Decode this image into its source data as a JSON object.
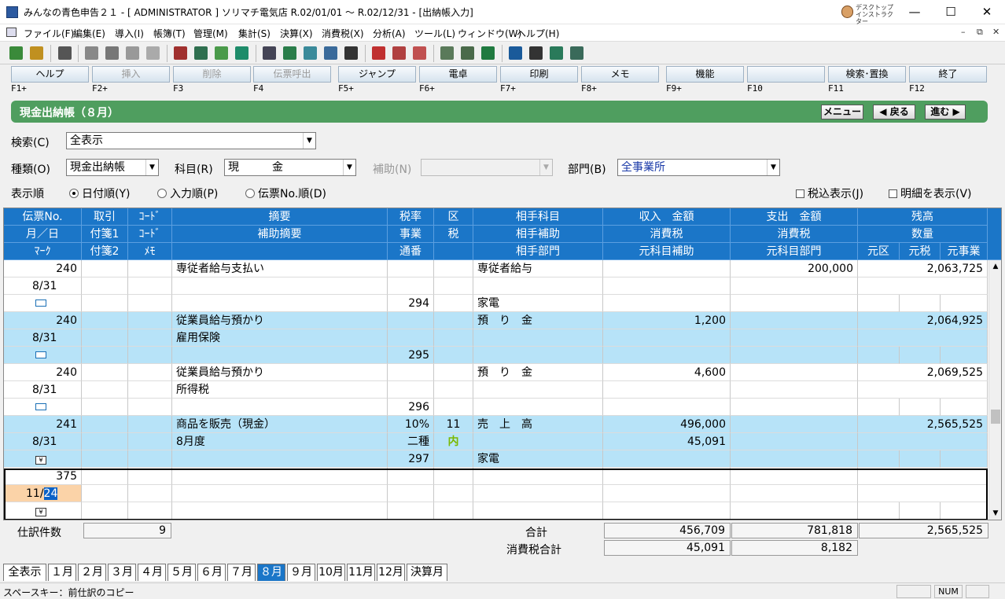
{
  "title": "みんなの青色申告２１ - [ ADMINISTRATOR ] ソリマチ電気店 R.02/01/01 ～ R.02/12/31 - [出納帳入力]",
  "desktop_instructor": [
    "デスクトップ",
    "インストラクター"
  ],
  "window_controls": {
    "min": "—",
    "max": "☐",
    "close": "✕"
  },
  "mdi_controls": {
    "min": "–",
    "restore": "⧉",
    "close": "✕"
  },
  "menu": [
    "ファイル(F)",
    "編集(E)",
    "導入(I)",
    "帳簿(T)",
    "管理(M)",
    "集計(S)",
    "決算(X)",
    "消費税(X)",
    "分析(A)",
    "ツール(L)",
    "ウィンドウ(W)",
    "ヘルプ(H)"
  ],
  "fkeys": [
    {
      "label": "ヘルプ",
      "key": "F1+",
      "disabled": false
    },
    {
      "label": "挿入",
      "key": "F2+",
      "disabled": true
    },
    {
      "label": "削除",
      "key": "F3",
      "disabled": true
    },
    {
      "label": "伝票呼出",
      "key": "F4",
      "disabled": true
    },
    {
      "label": "ジャンプ",
      "key": "F5+",
      "disabled": false
    },
    {
      "label": "電卓",
      "key": "F6+",
      "disabled": false
    },
    {
      "label": "印刷",
      "key": "F7+",
      "disabled": false
    },
    {
      "label": "メモ",
      "key": "F8+",
      "disabled": false
    },
    {
      "label": "機能",
      "key": "F9+",
      "disabled": false
    },
    {
      "label": "",
      "key": "F10",
      "disabled": false
    },
    {
      "label": "検索･置換",
      "key": "F11",
      "disabled": false
    },
    {
      "label": "終了",
      "key": "F12",
      "disabled": false
    }
  ],
  "header": {
    "title": "現金出納帳（８月）",
    "menu_btn": "メニュー",
    "back_btn": "◀ 戻る",
    "next_btn": "進む ▶"
  },
  "search": {
    "label": "検索(C)",
    "value": "全表示"
  },
  "kind": {
    "label": "種類(O)",
    "value": "現金出納帳"
  },
  "account": {
    "label": "科目(R)",
    "value": "現　　　金"
  },
  "sub": {
    "label": "補助(N)",
    "value": ""
  },
  "dept": {
    "label": "部門(B)",
    "value": "全事業所"
  },
  "order": {
    "label": "表示順",
    "options": [
      "日付順(Y)",
      "入力順(P)",
      "伝票No.順(D)"
    ]
  },
  "tax_incl": "税込表示(J)",
  "detail_show": "明細を表示(V)",
  "columns": {
    "row1": [
      "伝票No.",
      "取引",
      "ｺｰﾄﾞ",
      "摘要",
      "税率",
      "区",
      "相手科目",
      "収入　金額",
      "支出　金額",
      "残高"
    ],
    "row2": [
      "月／日",
      "付箋1",
      "ｺｰﾄﾞ",
      "補助摘要",
      "事業",
      "税",
      "相手補助",
      "消費税",
      "消費税",
      "数量"
    ],
    "row3": [
      "ﾏｰｸ",
      "付箋2",
      "ﾒﾓ",
      "",
      "通番",
      "",
      "相手部門",
      "元科目補助",
      "元科目部門",
      "元区",
      "元税",
      "元事業"
    ]
  },
  "entries": [
    {
      "no": "240",
      "date": "8/31",
      "mark": "card",
      "tekiyo": "専従者給与支払い",
      "hojo": "",
      "rate": "",
      "biz": "",
      "tsuban": "294",
      "ku": "",
      "zei": "",
      "aite": "専従者給与",
      "aite_hojo": "",
      "aite_bumon": "家電",
      "income": "",
      "income_tax": "",
      "expense": "200,000",
      "expense_tax": "",
      "balance": "2,063,725",
      "blue": false
    },
    {
      "no": "240",
      "date": "8/31",
      "mark": "card",
      "tekiyo": "従業員給与預かり",
      "hojo": "雇用保険",
      "rate": "",
      "biz": "",
      "tsuban": "295",
      "ku": "",
      "zei": "",
      "aite": "預　り　金",
      "aite_hojo": "",
      "aite_bumon": "",
      "income": "1,200",
      "income_tax": "",
      "expense": "",
      "expense_tax": "",
      "balance": "2,064,925",
      "blue": true
    },
    {
      "no": "240",
      "date": "8/31",
      "mark": "card",
      "tekiyo": "従業員給与預かり",
      "hojo": "所得税",
      "rate": "",
      "biz": "",
      "tsuban": "296",
      "ku": "",
      "zei": "",
      "aite": "預　り　金",
      "aite_hojo": "",
      "aite_bumon": "",
      "income": "4,600",
      "income_tax": "",
      "expense": "",
      "expense_tax": "",
      "balance": "2,069,525",
      "blue": false
    },
    {
      "no": "241",
      "date": "8/31",
      "mark": "yen",
      "tekiyo": "商品を販売（現金）",
      "hojo": "8月度",
      "rate": "10%",
      "biz": "二種",
      "tsuban": "297",
      "ku": "11",
      "zei": "内",
      "aite": "売　上　高",
      "aite_hojo": "",
      "aite_bumon": "家電",
      "income": "496,000",
      "income_tax": "45,091",
      "expense": "",
      "expense_tax": "",
      "balance": "2,565,525",
      "blue": true
    }
  ],
  "new_entry": {
    "no": "375",
    "date_prefix": "11/",
    "date_sel": "24",
    "mark": "yen"
  },
  "footer": {
    "count_label": "仕訳件数",
    "count": "9",
    "total_label": "合計",
    "tax_total_label": "消費税合計",
    "income_total": "456,709",
    "expense_total": "781,818",
    "balance_total": "2,565,525",
    "income_tax_total": "45,091",
    "expense_tax_total": "8,182"
  },
  "tabs": [
    "全表示",
    "１月",
    "２月",
    "３月",
    "４月",
    "５月",
    "６月",
    "７月",
    "８月",
    "９月",
    "10月",
    "11月",
    "12月",
    "決算月"
  ],
  "active_tab": 8,
  "status": {
    "text": "スペースキー：前仕訳のコピー",
    "num": "NUM"
  },
  "colors": {
    "header_blue": "#1b76c8",
    "row_blue": "#b7e3f8",
    "title_green": "#4f9e5f",
    "tax_zei": "#7ab800"
  }
}
